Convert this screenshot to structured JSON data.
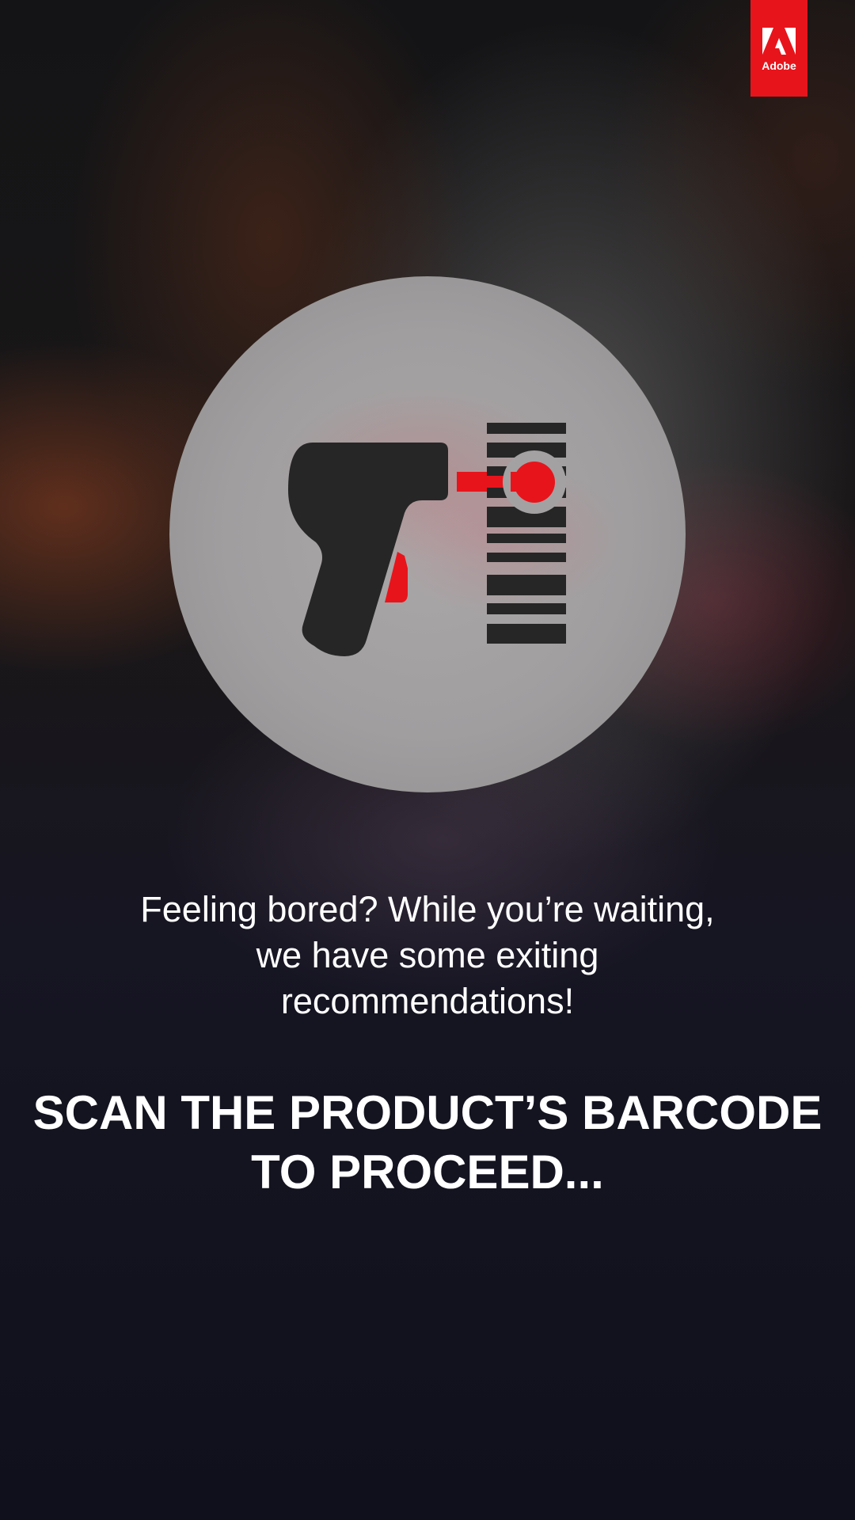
{
  "brand": {
    "name": "Adobe",
    "color": "#e8141b"
  },
  "illustration": {
    "icon": "barcode-scanner-icon",
    "accent_color": "#e8141b",
    "shape_color": "#262626"
  },
  "message": {
    "lines": [
      "Feeling bored? While you’re waiting,",
      "we have some exiting",
      "recommendations!"
    ]
  },
  "instruction": {
    "lines": [
      "SCAN THE PRODUCT’S BARCODE",
      "TO PROCEED..."
    ]
  }
}
